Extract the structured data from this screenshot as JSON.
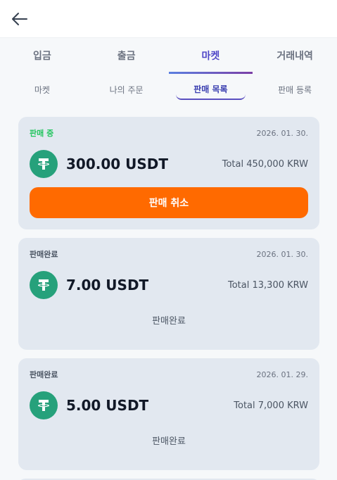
{
  "header": {
    "back_icon": "arrow-left-icon"
  },
  "tabs": [
    {
      "label": "입금",
      "active": false
    },
    {
      "label": "출금",
      "active": false
    },
    {
      "label": "마켓",
      "active": true
    },
    {
      "label": "거래내역",
      "active": false
    }
  ],
  "subtabs": [
    {
      "label": "마켓",
      "active": false
    },
    {
      "label": "나의 주문",
      "active": false
    },
    {
      "label": "판매 목록",
      "active": true
    },
    {
      "label": "판매 등록",
      "active": false
    }
  ],
  "colors": {
    "accent": "#4f46c8",
    "cancel": "#ff6a00",
    "live": "#22c55e",
    "tether": "#26a17b"
  },
  "listings": [
    {
      "status": "판매 중",
      "date": "2026. 01. 30.",
      "amount": "300.00 USDT",
      "total": "Total 450,000 KRW",
      "action": "판매 취소",
      "coin_icon": "tether-icon"
    },
    {
      "status": "판매완료",
      "date": "2026. 01. 30.",
      "amount": "7.00 USDT",
      "total": "Total 13,300 KRW",
      "result": "판매완료",
      "coin_icon": "tether-icon"
    },
    {
      "status": "판매완료",
      "date": "2026. 01. 29.",
      "amount": "5.00 USDT",
      "total": "Total 7,000 KRW",
      "result": "판매완료",
      "coin_icon": "tether-icon"
    }
  ]
}
